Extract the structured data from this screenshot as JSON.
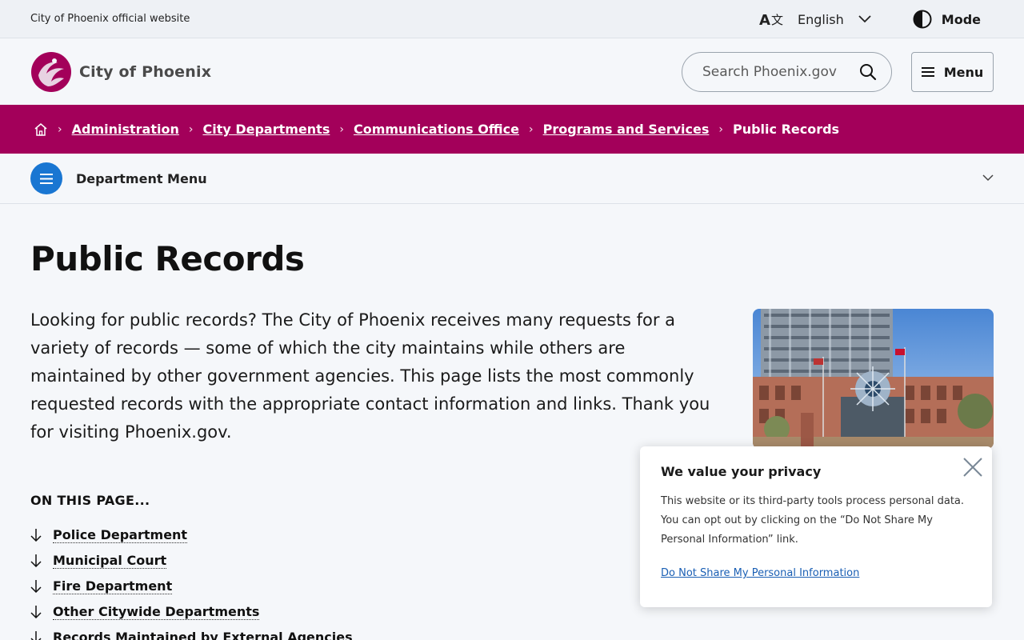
{
  "topbar": {
    "official_text": "City of Phoenix official website",
    "language": "English",
    "mode_label": "Mode"
  },
  "header": {
    "logo_text": "City of Phoenix",
    "search_placeholder": "Search Phoenix.gov",
    "menu_label": "Menu",
    "brand_color": "#a3005a"
  },
  "breadcrumb": {
    "items": [
      "Administration",
      "City Departments",
      "Communications Office",
      "Programs and Services"
    ],
    "current": "Public Records"
  },
  "department_menu": {
    "label": "Department Menu",
    "accent": "#1976d2"
  },
  "main": {
    "title": "Public Records",
    "intro": "Looking for public records? The City of Phoenix receives many requests for a variety of records — some of which the city maintains while others are maintained by other government agencies. This page lists the most commonly requested records with the appropriate contact information and links. Thank you for visiting Phoenix.gov.",
    "on_this_page": {
      "heading": "ON THIS PAGE...",
      "links": [
        "Police Department",
        "Municipal Court",
        "Fire Department",
        "Other Citywide Departments",
        "Records Maintained by External Agencies"
      ]
    }
  },
  "privacy": {
    "title": "We value your privacy",
    "body": "This website or its third-party tools process personal data. You can opt out by clicking on the “Do Not Share My Personal Information” link.",
    "link": "Do Not Share My Personal Information"
  }
}
